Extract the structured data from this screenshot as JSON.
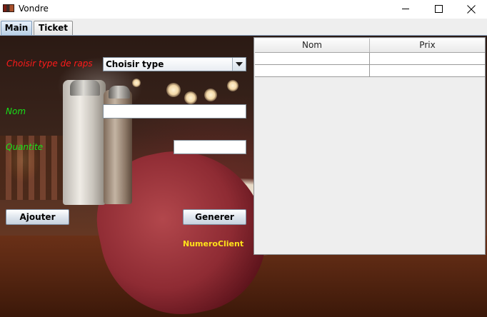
{
  "window": {
    "title": "Vondre"
  },
  "tabs": [
    {
      "label": "Main",
      "selected": true
    },
    {
      "label": "Ticket",
      "selected": false
    }
  ],
  "form": {
    "type_label": "Choisir type de raps",
    "type_select": {
      "selected": "Choisir type"
    },
    "nom_label": "Nom",
    "nom_value": "",
    "quantite_label": "Quantite",
    "quantite_value": "",
    "ajouter_label": "Ajouter",
    "generer_label": "Generer",
    "numero_client_label": "NumeroClient"
  },
  "table": {
    "columns": [
      "Nom",
      "Prix"
    ],
    "rows": [
      [
        "",
        ""
      ],
      [
        "",
        ""
      ]
    ]
  },
  "colors": {
    "type_label": "#ff1a1a",
    "field_labels": "#18e018",
    "numero_client": "#ffe21a"
  }
}
